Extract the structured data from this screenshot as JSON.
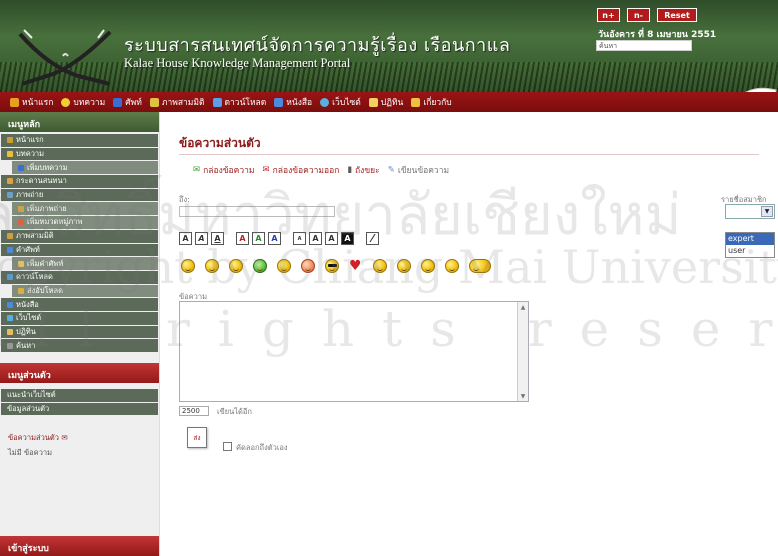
{
  "header": {
    "title_th": "ระบบสารสนเทศน์จัดการความรู้เรื่อง เรือนกาแล",
    "title_en": "Kalae House Knowledge Management Portal",
    "font_increase": "n+",
    "font_decrease": "n-",
    "reset": "Reset",
    "date": "วันอังคาร ที่ 8 เมษายน 2551",
    "search_placeholder": "ค้นหา"
  },
  "nav": [
    {
      "label": "หน้าแรก",
      "icon": "home-icon",
      "color": "#e8a020"
    },
    {
      "label": "บทความ",
      "icon": "lightbulb-icon",
      "color": "#f0d030"
    },
    {
      "label": "ศัพท์",
      "icon": "book-icon",
      "color": "#3a6ed6"
    },
    {
      "label": "ภาพสามมิติ",
      "icon": "pencil-icon",
      "color": "#e0c040"
    },
    {
      "label": "ดาวน์โหลด",
      "icon": "download-icon",
      "color": "#5aa0e8"
    },
    {
      "label": "หนังสือ",
      "icon": "books-icon",
      "color": "#4a8ae0"
    },
    {
      "label": "เว็บไซต์",
      "icon": "globe-icon",
      "color": "#58b0e0"
    },
    {
      "label": "ปฏิทิน",
      "icon": "calendar-icon",
      "color": "#f2d060"
    },
    {
      "label": "เกี่ยวกับ",
      "icon": "folder-icon",
      "color": "#f0c040"
    }
  ],
  "sidebar": {
    "main_menu_title": "เมนูหลัก",
    "main_menu": [
      {
        "label": "หน้าแรก",
        "sub": false
      },
      {
        "label": "บทความ",
        "sub": false
      },
      {
        "label": "เพิ่มบทความ",
        "sub": true
      },
      {
        "label": "กระดานสนทนา",
        "sub": false
      },
      {
        "label": "ภาพถ่าย",
        "sub": false
      },
      {
        "label": "เพิ่มภาพถ่าย",
        "sub": true
      },
      {
        "label": "เพิ่มหมวดหมู่ภาพ",
        "sub": true
      },
      {
        "label": "ภาพสามมิติ",
        "sub": false
      },
      {
        "label": "คำศัพท์",
        "sub": false
      },
      {
        "label": "เพิ่มคำศัพท์",
        "sub": true
      },
      {
        "label": "ดาวน์โหลด",
        "sub": false
      },
      {
        "label": "ส่งอัปโหลด",
        "sub": true
      },
      {
        "label": "หนังสือ",
        "sub": false
      },
      {
        "label": "เว็บไซต์",
        "sub": false
      },
      {
        "label": "ปฏิทิน",
        "sub": false
      },
      {
        "label": "ค้นหา",
        "sub": false
      }
    ],
    "personal_menu_title": "เมนูส่วนตัว",
    "personal_menu": [
      "แนะนำเว็บไซต์",
      "ข้อมูลส่วนตัว"
    ],
    "private_msg_link": "ข้อความส่วนตัว",
    "private_msg_note": "ไม่มี ข้อความ",
    "login_title": "เข้าสู่ระบบ"
  },
  "main": {
    "page_title": "ข้อความส่วนตัว",
    "tabs": [
      {
        "label": "กล่องข้อความ",
        "icon": "inbox-icon"
      },
      {
        "label": "กล่องข้อความออก",
        "icon": "outbox-icon"
      },
      {
        "label": "ถังขยะ",
        "icon": "trash-icon"
      },
      {
        "label": "เขียนข้อความ",
        "icon": "compose-icon"
      }
    ],
    "to_label": "ถึง:",
    "members_label": "รายชื่อสมาชิก",
    "members_options": [
      "expert",
      "user"
    ],
    "members_selected": "expert",
    "format_buttons": [
      "A",
      "A",
      "A",
      "A",
      "A",
      "A",
      "A",
      "A",
      "A",
      "A",
      "⁄"
    ],
    "message_label": "ข้อความ",
    "char_count": "2500",
    "char_count_label": "เขียนได้อีก",
    "send_label": "ส่ง",
    "copy_self_label": "คัดลอกถึงตัวเอง"
  },
  "watermark": {
    "line1": "ลิขสิทธิ์มหาวิทยาลัยเชียงใหม่",
    "line2": "Copyright by Chiang Mai University",
    "line3": "All rights reserved"
  }
}
